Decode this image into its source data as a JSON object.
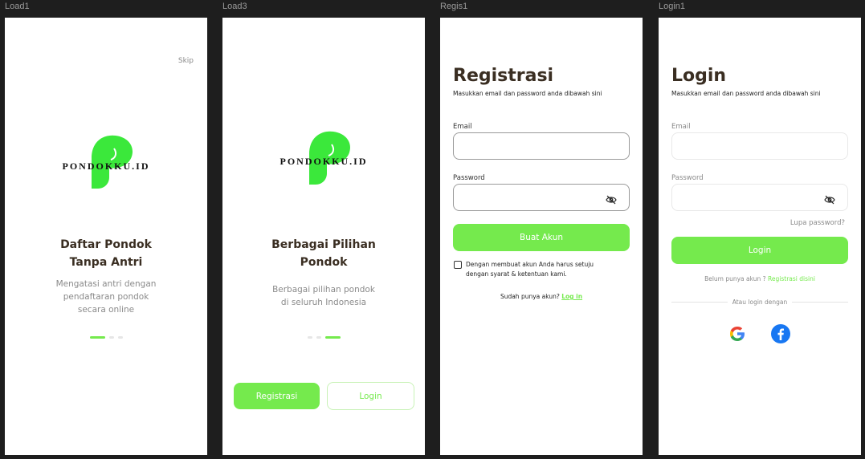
{
  "frames": {
    "load1": {
      "name": "Load1",
      "skip": "Skip",
      "logo_text": "PONDOKKU.ID",
      "title_line1": "Daftar Pondok",
      "title_line2": "Tanpa Antri",
      "desc_line1": "Mengatasi antri dengan",
      "desc_line2": "pendaftaran pondok",
      "desc_line3": "secara online",
      "active_page": 1
    },
    "load3": {
      "name": "Load3",
      "logo_text": "PONDOKKU.ID",
      "title_line1": "Berbagai Pilihan",
      "title_line2": "Pondok",
      "desc_line1": "Berbagai pilihan pondok",
      "desc_line2": "di seluruh Indonesia",
      "active_page": 3,
      "register_label": "Registrasi",
      "login_label": "Login"
    },
    "regis1": {
      "name": "Regis1",
      "title": "Registrasi",
      "subtitle": "Masukkan email dan password anda dibawah sini",
      "email_label": "Email",
      "password_label": "Password",
      "button_label": "Buat Akun",
      "terms_line1": "Dengan membuat akun Anda harus setuju",
      "terms_line2": "dengan syarat & ketentuan kami.",
      "have_account": "Sudah punya akun?",
      "login_link": "Log in"
    },
    "login1": {
      "name": "Login1",
      "title": "Login",
      "subtitle": "Masukkan email dan password anda dibawah sini",
      "email_label": "Email",
      "password_label": "Password",
      "forgot": "Lupa password?",
      "button_label": "Login",
      "no_account": "Belum punya akun ?",
      "register_link": "Registrasi disini",
      "divider": "Atau login dengan"
    }
  },
  "colors": {
    "accent": "#75ea4d",
    "brand_text": "#3a2e22",
    "muted": "#8a8a8a"
  },
  "icons": [
    "eye-off-icon",
    "google-icon",
    "facebook-icon",
    "pondokku-logo"
  ]
}
